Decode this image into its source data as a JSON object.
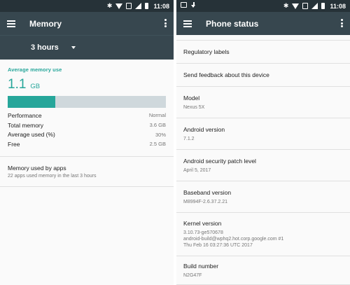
{
  "colors": {
    "appbar": "#37474f",
    "statusbar": "#263238",
    "accent": "#26a69a",
    "bar_track": "#cfd8dc"
  },
  "left": {
    "status_time": "11:08",
    "title": "Memory",
    "period": "3 hours",
    "average": {
      "label": "Average memory use",
      "value": "1.1",
      "unit": "GB",
      "fraction_used": 0.3
    },
    "stats": [
      {
        "label": "Performance",
        "value": "Normal"
      },
      {
        "label": "Total memory",
        "value": "3.6 GB"
      },
      {
        "label": "Average used (%)",
        "value": "30%"
      },
      {
        "label": "Free",
        "value": "2.5 GB"
      }
    ],
    "apps": {
      "title": "Memory used by apps",
      "subtitle": "22 apps used memory in the last 3 hours"
    }
  },
  "right": {
    "status_time": "11:08",
    "title": "Phone status",
    "items": [
      {
        "title": "Regulatory labels",
        "subtitle": ""
      },
      {
        "title": "Send feedback about this device",
        "subtitle": ""
      },
      {
        "title": "Model",
        "subtitle": "Nexus 5X"
      },
      {
        "title": "Android version",
        "subtitle": "7.1.2"
      },
      {
        "title": "Android security patch level",
        "subtitle": "April 5, 2017"
      },
      {
        "title": "Baseband version",
        "subtitle": "M8994F-2.6.37.2.21"
      },
      {
        "title": "Kernel version",
        "subtitle": "3.10.73-ge570678\nandroid-build@wphq2.hot.corp.google.com #1\nThu Feb 16 03:27:36 UTC 2017"
      },
      {
        "title": "Build number",
        "subtitle": "N2G47F"
      }
    ]
  }
}
